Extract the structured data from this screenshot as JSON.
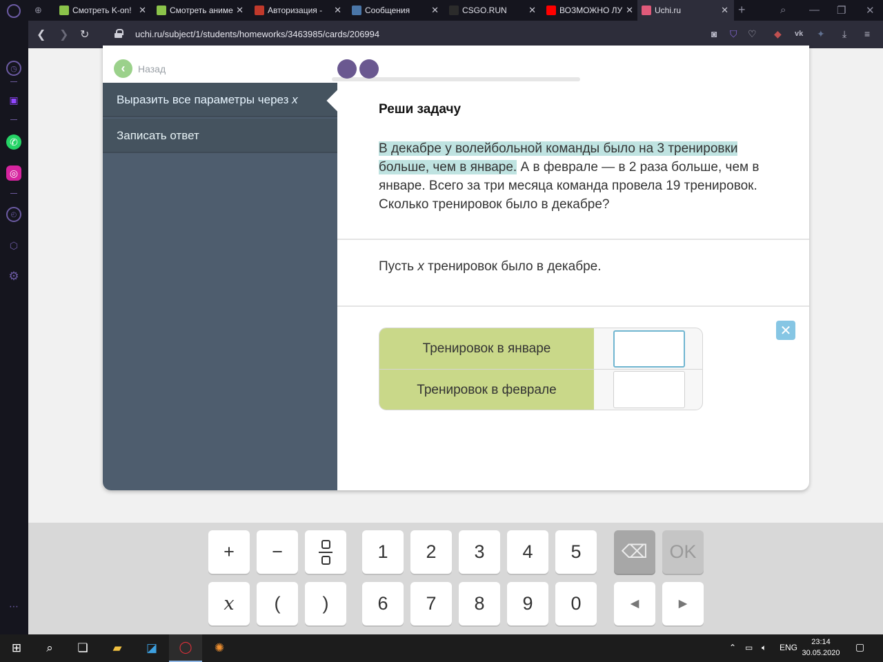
{
  "browser": {
    "tabs": [
      {
        "label": "Смотреть K-on!",
        "favicon_color": "#8bc34a",
        "active": false
      },
      {
        "label": "Смотреть аниме",
        "favicon_color": "#8bc34a",
        "active": false
      },
      {
        "label": "Авторизация - ",
        "favicon_color": "#c0392b",
        "active": false
      },
      {
        "label": "Сообщения",
        "favicon_color": "#4a76a8",
        "active": false
      },
      {
        "label": "CSGO.RUN",
        "favicon_color": "#2b2b2b",
        "active": false
      },
      {
        "label": "ВОЗМОЖНО ЛУ",
        "favicon_color": "#ff0000",
        "active": false
      },
      {
        "label": "Uchi.ru",
        "favicon_color": "#e05a7a",
        "active": true
      }
    ],
    "url": "uchi.ru/subject/1/students/homeworks/3463985/cards/206994"
  },
  "lesson": {
    "back_label": "Назад",
    "steps": [
      {
        "label": "Выразить все параметры через ",
        "var": "x"
      },
      {
        "label": "Записать ответ",
        "var": ""
      }
    ],
    "task_title": "Реши задачу",
    "task_highlight": "В декабре у волейбольной команды было на 3 тренировки больше, чем в январе.",
    "task_rest": " А в феврале — в 2 раза больше, чем в январе. Всего за три месяца команда провела 19 тренировок. Сколько тренировок было в декабре?",
    "let_prefix": "Пусть ",
    "let_var": "x",
    "let_suffix": " тренировок было в декабре.",
    "table": [
      {
        "label": "Тренировок в январе",
        "value": ""
      },
      {
        "label": "Тренировок в феврале",
        "value": ""
      }
    ],
    "progress_done": 2
  },
  "keyboard": {
    "row1": [
      "+",
      "−",
      "frac",
      "1",
      "2",
      "3",
      "4",
      "5",
      "⌫",
      "OK"
    ],
    "row2": [
      "x",
      "(",
      ")",
      "6",
      "7",
      "8",
      "9",
      "0",
      "◄",
      "►"
    ]
  },
  "taskbar": {
    "lang": "ENG",
    "time": "23:14",
    "date": "30.05.2020"
  }
}
